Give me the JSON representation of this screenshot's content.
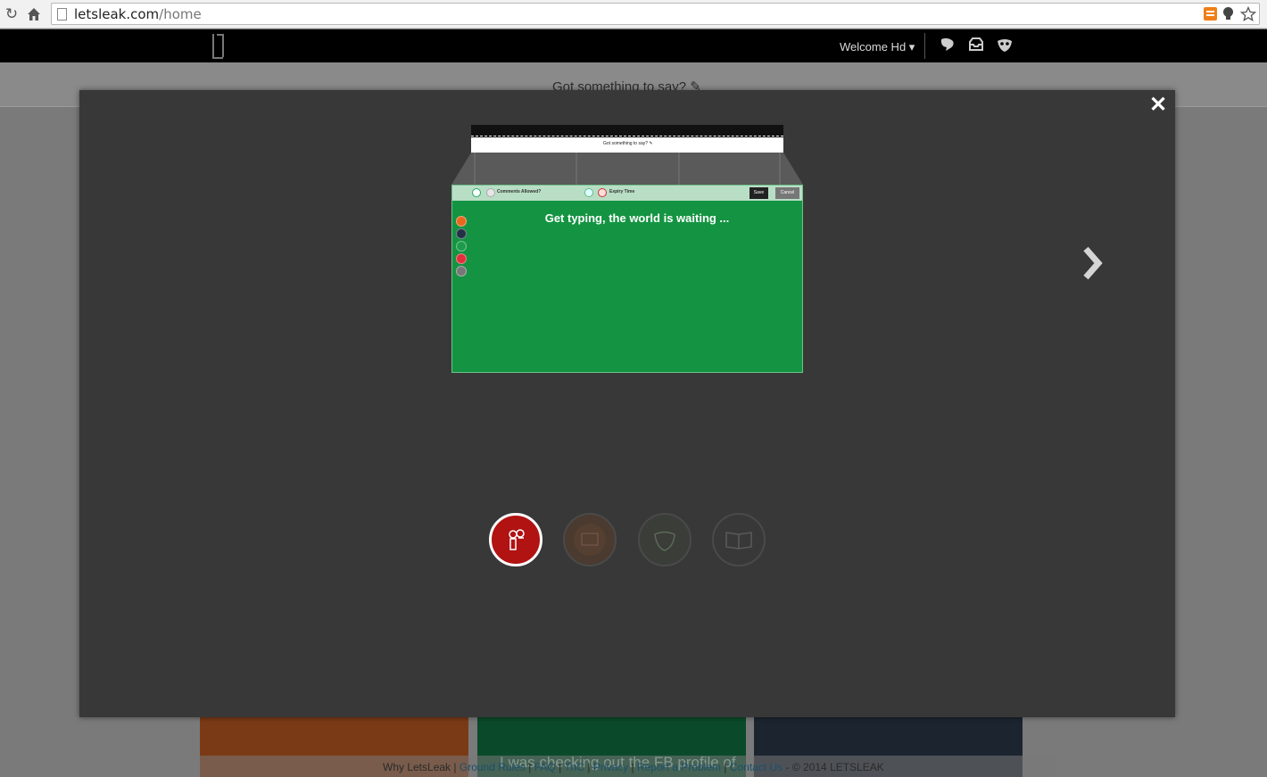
{
  "browser": {
    "url_host": "letsleak.com",
    "url_path": "/home"
  },
  "header": {
    "welcome": "Welcome Hd ▾"
  },
  "background": {
    "prompt": "Got something to say? ✎",
    "ghost_post": "I was checking out the FB profile of",
    "footer": {
      "why": "Why LetsLeak",
      "ground_rules": "Ground Rules",
      "faq": "FAQ",
      "tnc": "TnC",
      "privacy": "Privacy",
      "report": "Report a Problem",
      "contact": "Contact Us",
      "copyright": "- © 2014 LETSLEAK",
      "sep": "|"
    },
    "card_colors": [
      "#7a3a16",
      "#0a4a2a",
      "#1c2430"
    ]
  },
  "modal": {
    "close_label": "✕",
    "preview": {
      "bar_text": "Got something to say? ✎",
      "comments_label": "Comments Allowed?",
      "expiry_label": "Expiry Time",
      "save_label": "Save",
      "cancel_label": "Cancel",
      "headline": "Get typing, the world is waiting ...",
      "swatches": [
        "#e8681e",
        "#233146",
        "#1e9a4b",
        "#e0303b",
        "#777777"
      ]
    },
    "steps": [
      {
        "name": "people-icon",
        "active": true
      },
      {
        "name": "post-icon",
        "active": false
      },
      {
        "name": "mask-icon",
        "active": false
      },
      {
        "name": "book-icon",
        "active": false
      }
    ]
  }
}
